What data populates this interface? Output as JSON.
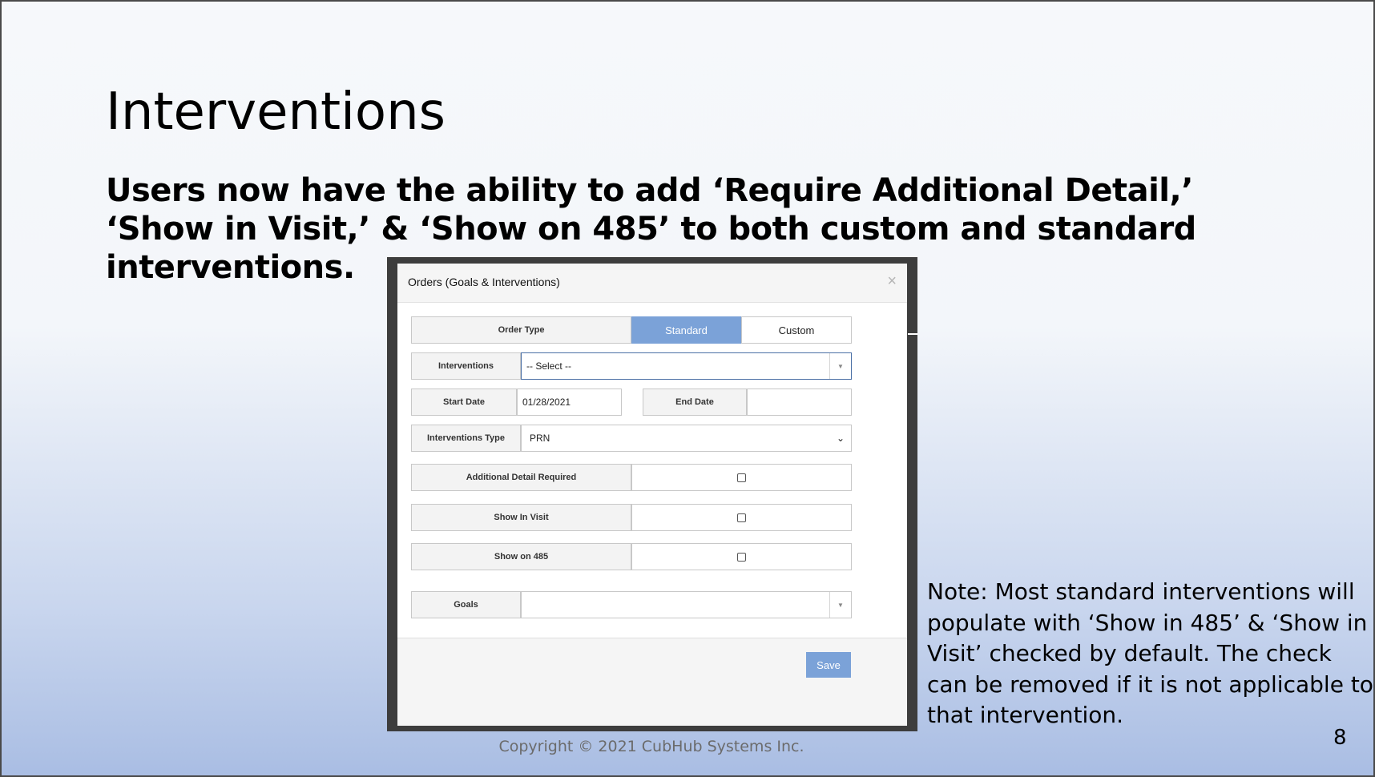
{
  "slide": {
    "title": "Interventions",
    "subtitle": "Users now have the ability to add ‘Require Additional Detail,’ ‘Show in Visit,’ & ‘Show on 485’ to both custom and standard interventions.",
    "note": "Note: Most standard interventions will populate with ‘Show in 485’ & ‘Show in Visit’ checked by default. The check can be removed if it is not applicable to that intervention.",
    "copyright": "Copyright © 2021 CubHub Systems Inc.",
    "page_number": "8"
  },
  "modal": {
    "title": "Orders (Goals & Interventions)",
    "close_icon": "close-icon",
    "order_type": {
      "label": "Order Type",
      "options": [
        "Standard",
        "Custom"
      ],
      "selected": "Standard"
    },
    "interventions": {
      "label": "Interventions",
      "value": "-- Select --"
    },
    "start_date": {
      "label": "Start Date",
      "value": "01/28/2021"
    },
    "end_date": {
      "label": "End Date",
      "value": ""
    },
    "interventions_type": {
      "label": "Interventions Type",
      "value": "PRN"
    },
    "additional_detail": {
      "label": "Additional Detail Required",
      "checked": false
    },
    "show_in_visit": {
      "label": "Show In Visit",
      "checked": false
    },
    "show_on_485": {
      "label": "Show on 485",
      "checked": false
    },
    "goals": {
      "label": "Goals",
      "value": ""
    },
    "save_label": "Save"
  },
  "colors": {
    "accent": "#7ba2d8",
    "frame": "#3d3d3d"
  }
}
